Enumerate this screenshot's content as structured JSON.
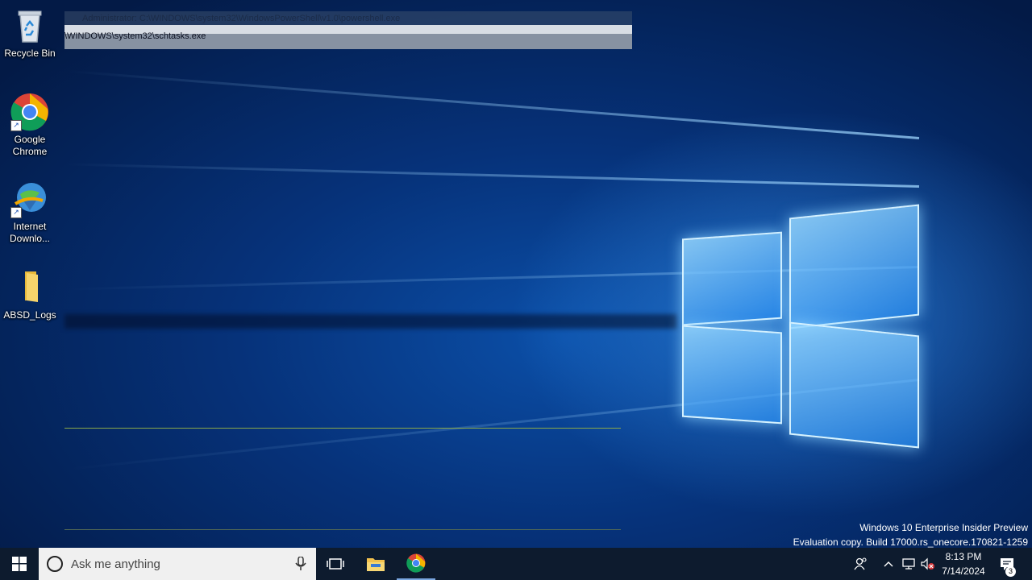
{
  "desktop": {
    "icons": [
      {
        "label_line1": "Recycle Bin",
        "label_line2": "",
        "icon": "recycle-bin-icon"
      },
      {
        "label_line1": "Google",
        "label_line2": "Chrome",
        "icon": "chrome-icon"
      },
      {
        "label_line1": "Internet",
        "label_line2": "Downlo...",
        "icon": "internet-download-manager-icon"
      },
      {
        "label_line1": "ABSD_Logs",
        "label_line2": "",
        "icon": "folder-icon"
      }
    ]
  },
  "overlay_windows": {
    "powershell_title": "Administrator: C:\\WINDOWS\\system32\\WindowsPowerShell\\v1.0\\powershell.exe",
    "schtasks_path": "\\WINDOWS\\system32\\schtasks.exe"
  },
  "watermark": {
    "line1": "Windows 10 Enterprise Insider Preview",
    "line2": "Evaluation copy. Build 17000.rs_onecore.170821-1259"
  },
  "taskbar": {
    "search_placeholder": "Ask me anything",
    "pinned": [
      "task-view-icon",
      "file-explorer-icon",
      "chrome-icon"
    ],
    "tray_icons": [
      "people-icon",
      "chevron-up-icon",
      "network-icon",
      "volume-muted-icon"
    ],
    "clock_time": "8:13 PM",
    "clock_date": "7/14/2024",
    "notification_count": "3"
  },
  "colors": {
    "taskbar_bg": "#0d1b2e",
    "desktop_accent": "#0b4fa8"
  }
}
